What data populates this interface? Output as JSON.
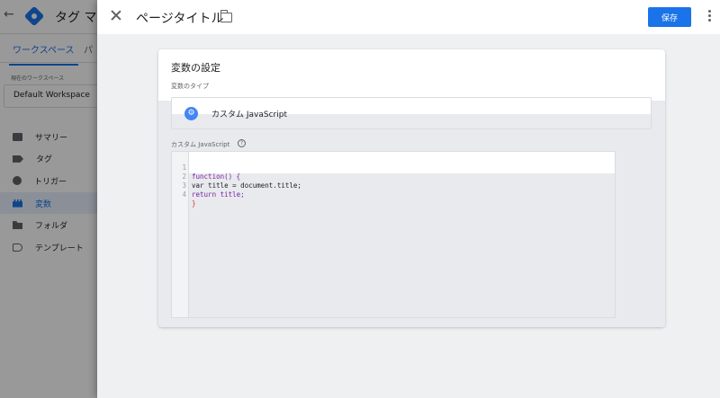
{
  "background": {
    "back_label": "←",
    "title": "タグ マ",
    "tabs": [
      "ワークスペース",
      "パ"
    ],
    "workspace_label": "現在のワークスペース",
    "workspace_name": "Default Workspace",
    "nav_items": [
      {
        "label": "サマリー",
        "icon": "summary-icon"
      },
      {
        "label": "タグ",
        "icon": "tag-icon"
      },
      {
        "label": "トリガー",
        "icon": "trigger-icon"
      },
      {
        "label": "変数",
        "icon": "variable-icon",
        "active": true
      },
      {
        "label": "フォルダ",
        "icon": "folder-icon"
      },
      {
        "label": "テンプレート",
        "icon": "template-icon"
      }
    ]
  },
  "header": {
    "title": "ページタイトル",
    "save_label": "保存"
  },
  "card": {
    "title": "変数の設定",
    "type_label": "変数のタイプ",
    "type_name": "カスタム JavaScript",
    "js_label": "カスタム JavaScript",
    "help_label": "?"
  },
  "editor": {
    "line_numbers": [
      "1",
      "2",
      "3",
      "4"
    ],
    "lines": [
      "function() {",
      "var title = document.title;",
      "return title;",
      "}"
    ]
  },
  "colors": {
    "accent": "#1a73e8",
    "keyword": "#7b1fa2",
    "brace": "#d93025"
  }
}
